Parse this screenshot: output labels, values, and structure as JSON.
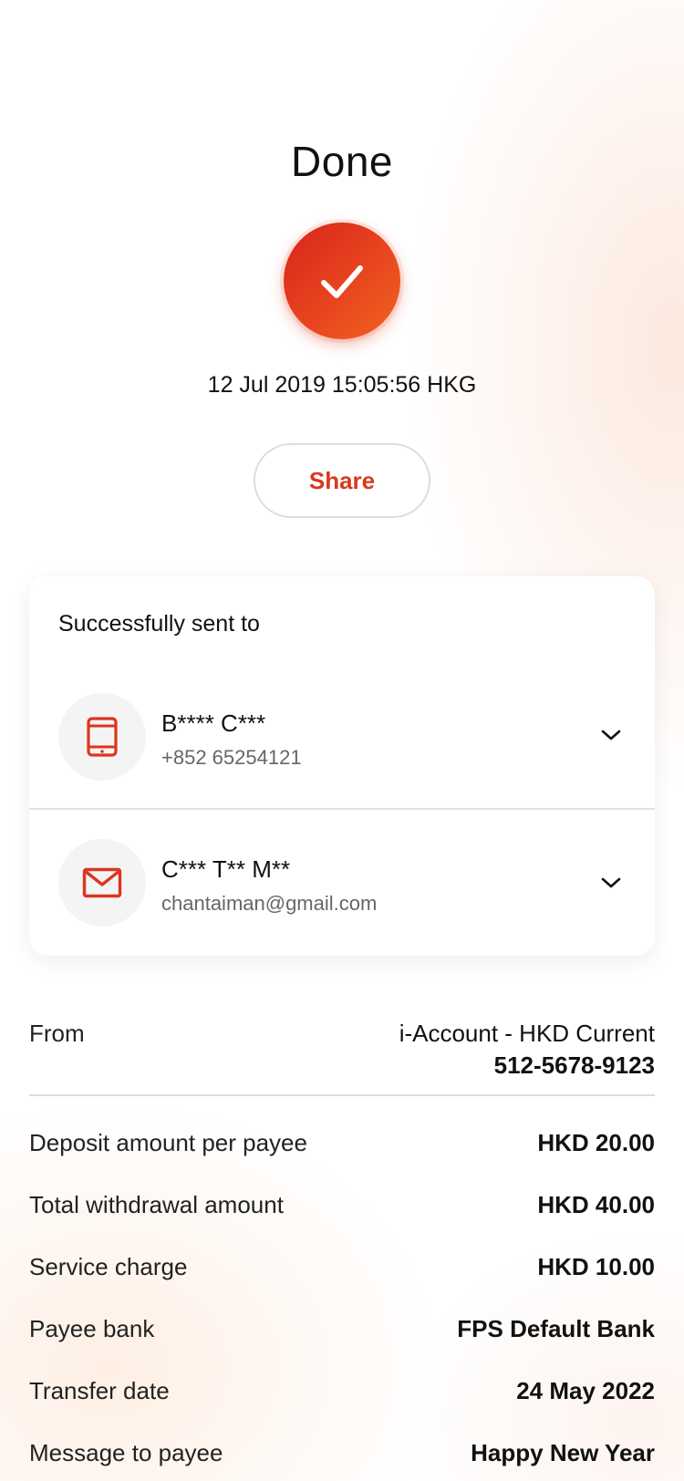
{
  "status": {
    "title": "Done",
    "datetime": "12 Jul 2019 15:05:56 HKG",
    "share_label": "Share",
    "accent_color": "#e13a1e"
  },
  "recipients_card": {
    "title": "Successfully sent to",
    "recipients": [
      {
        "icon": "mobile-phone-icon",
        "name": "B**** C***",
        "detail": "+852 65254121"
      },
      {
        "icon": "envelope-icon",
        "name": "C*** T** M**",
        "detail": "chantaiman@gmail.com"
      }
    ]
  },
  "details": {
    "from": {
      "label": "From",
      "account_name": "i-Account - HKD Current",
      "account_number": "512-5678-9123"
    },
    "rows": [
      {
        "label": "Deposit amount per payee",
        "value": "HKD 20.00"
      },
      {
        "label": "Total withdrawal amount",
        "value": "HKD 40.00"
      },
      {
        "label": "Service charge",
        "value": "HKD 10.00"
      },
      {
        "label": "Payee bank",
        "value": "FPS Default Bank"
      },
      {
        "label": "Transfer date",
        "value": "24 May 2022"
      },
      {
        "label": "Message to payee",
        "value": "Happy New Year"
      }
    ]
  }
}
